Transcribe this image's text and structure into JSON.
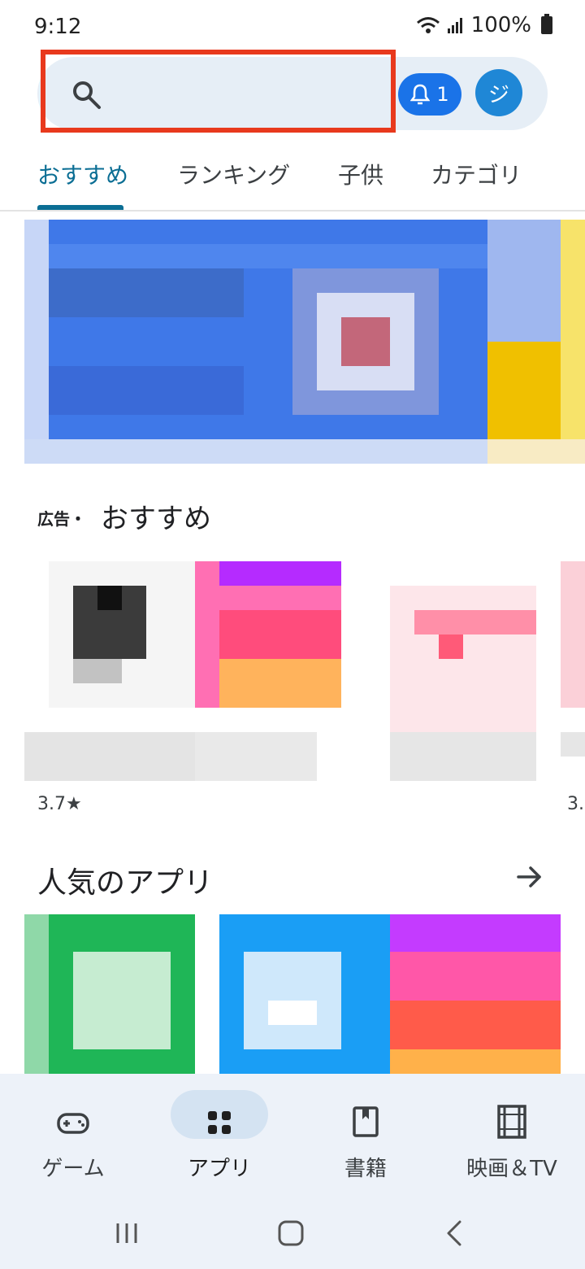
{
  "status_bar": {
    "time": "9:12",
    "battery": "100%"
  },
  "search": {
    "placeholder": ""
  },
  "header": {
    "notification_count": "1",
    "avatar_initial": "ジ"
  },
  "tabs": [
    {
      "label": "おすすめ",
      "active": true
    },
    {
      "label": "ランキング",
      "active": false
    },
    {
      "label": "子供",
      "active": false
    },
    {
      "label": "カテゴリ",
      "active": false
    }
  ],
  "section_recommended": {
    "ad_label": "広告・",
    "title": "おすすめ",
    "ratings": [
      "3.7★",
      "3."
    ]
  },
  "section_popular": {
    "title": "人気のアプリ"
  },
  "bottom_nav": [
    {
      "label": "ゲーム",
      "icon": "gamepad-icon"
    },
    {
      "label": "アプリ",
      "icon": "apps-icon",
      "active": true
    },
    {
      "label": "書籍",
      "icon": "book-icon"
    },
    {
      "label": "映画＆TV",
      "icon": "film-icon"
    }
  ],
  "colors": {
    "accent": "#0b6e94",
    "highlight": "#e8391d",
    "primary": "#1a73e8"
  }
}
